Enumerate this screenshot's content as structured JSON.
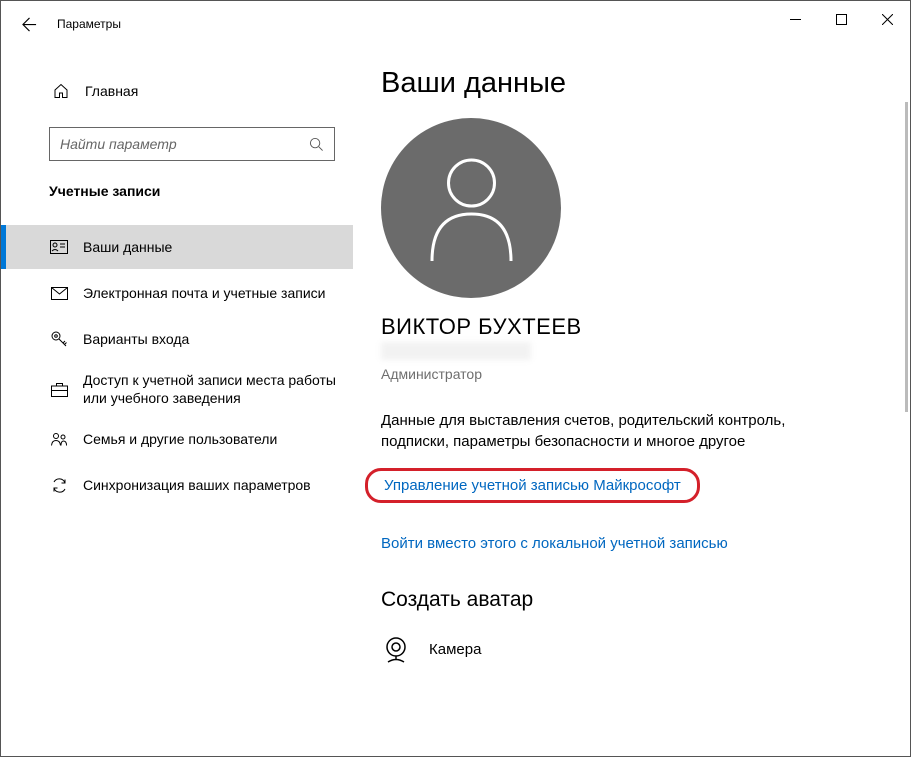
{
  "titlebar": {
    "title": "Параметры"
  },
  "sidebar": {
    "home_label": "Главная",
    "search_placeholder": "Найти параметр",
    "section_title": "Учетные записи",
    "items": [
      {
        "label": "Ваши данные",
        "icon": "user-card-icon",
        "active": true
      },
      {
        "label": "Электронная почта и учетные записи",
        "icon": "mail-icon",
        "active": false
      },
      {
        "label": "Варианты входа",
        "icon": "key-icon",
        "active": false
      },
      {
        "label": "Доступ к учетной записи места работы или учебного заведения",
        "icon": "briefcase-icon",
        "active": false
      },
      {
        "label": "Семья и другие пользователи",
        "icon": "people-icon",
        "active": false
      },
      {
        "label": "Синхронизация ваших параметров",
        "icon": "sync-icon",
        "active": false
      }
    ]
  },
  "main": {
    "page_title": "Ваши данные",
    "user_name": "ВИКТОР БУХТЕЕВ",
    "role": "Администратор",
    "description": "Данные для выставления счетов, родительский контроль, подписки, параметры безопасности и многое другое",
    "manage_link": "Управление учетной записью Майкрософт",
    "local_link": "Войти вместо этого с локальной учетной записью",
    "avatar_heading": "Создать аватар",
    "camera_label": "Камера"
  }
}
